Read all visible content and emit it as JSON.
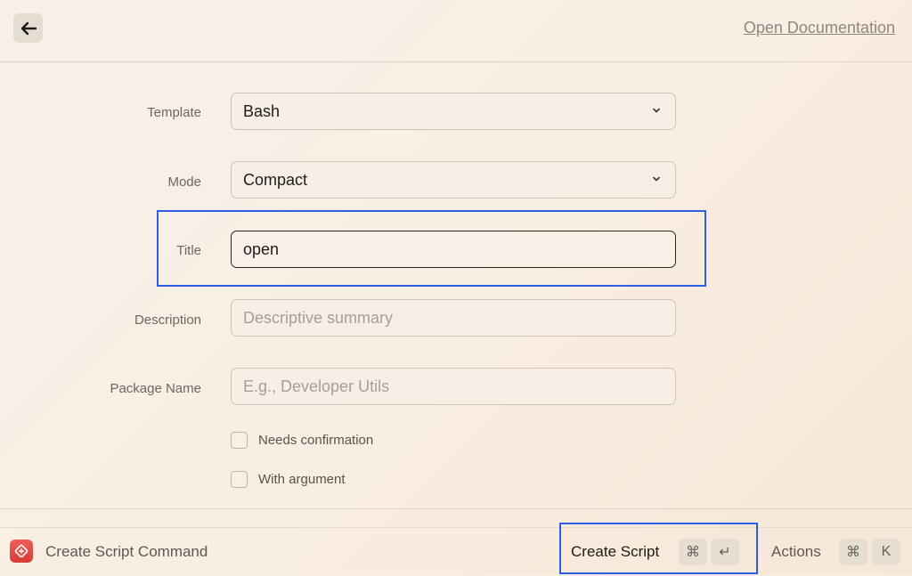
{
  "header": {
    "back_icon": "arrow-left-icon",
    "doc_link": "Open Documentation"
  },
  "form": {
    "template": {
      "label": "Template",
      "value": "Bash"
    },
    "mode": {
      "label": "Mode",
      "value": "Compact"
    },
    "title": {
      "label": "Title",
      "value": "open"
    },
    "description": {
      "label": "Description",
      "placeholder": "Descriptive summary"
    },
    "package": {
      "label": "Package Name",
      "placeholder": "E.g., Developer Utils"
    },
    "needs_confirmation": {
      "label": "Needs confirmation",
      "checked": false
    },
    "with_argument": {
      "label": "With argument",
      "checked": false
    }
  },
  "footer": {
    "app_icon": "script-app-icon",
    "title": "Create Script Command",
    "primary_action": "Create Script",
    "primary_keys": [
      "⌘",
      "↵"
    ],
    "secondary_action": "Actions",
    "secondary_keys": [
      "⌘",
      "K"
    ]
  },
  "colors": {
    "highlight": "#2f5ee6",
    "app_icon": "#e0483f"
  }
}
